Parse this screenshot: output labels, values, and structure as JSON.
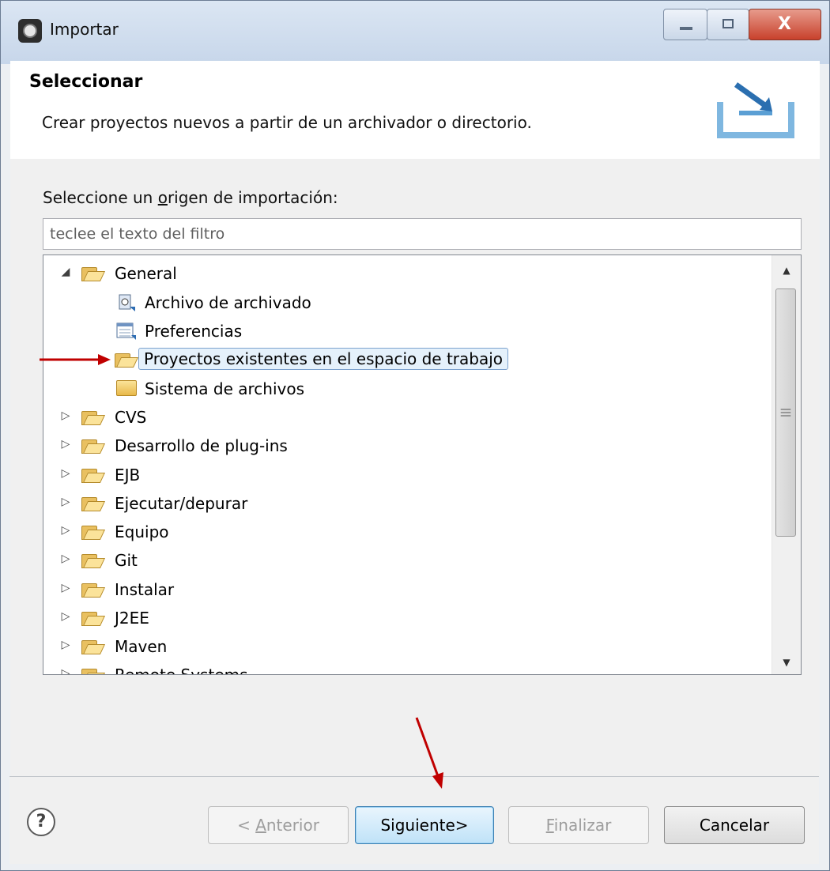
{
  "window": {
    "title": "Importar"
  },
  "header": {
    "title": "Seleccionar",
    "description": "Crear proyectos nuevos a partir de un archivador o directorio."
  },
  "source_label": {
    "prefix": "Seleccione un ",
    "mnemonic": "o",
    "suffix": "rigen de importación:"
  },
  "filter": {
    "value": "teclee el texto del filtro"
  },
  "tree": {
    "general": {
      "label": "General",
      "children": [
        {
          "label": "Archivo de archivado",
          "icon": "archive-icon"
        },
        {
          "label": "Preferencias",
          "icon": "preferences-icon"
        },
        {
          "label": "Proyectos existentes en el espacio de trabajo",
          "icon": "project-folder-icon",
          "selected": true
        },
        {
          "label": "Sistema de archivos",
          "icon": "folder-icon"
        }
      ]
    },
    "categories": [
      "CVS",
      "Desarrollo de plug-ins",
      "EJB",
      "Ejecutar/depurar",
      "Equipo",
      "Git",
      "Instalar",
      "J2EE",
      "Maven",
      "Remote Systems"
    ]
  },
  "buttons": {
    "prev": {
      "prefix": "< ",
      "mnemonic": "A",
      "suffix": "nterior",
      "enabled": false
    },
    "next": {
      "label": "Siguiente>",
      "enabled": true
    },
    "finish": {
      "mnemonic": "F",
      "suffix": "inalizar",
      "enabled": false
    },
    "cancel": {
      "label": "Cancelar",
      "enabled": true
    }
  },
  "annotation_color": "#c00000"
}
